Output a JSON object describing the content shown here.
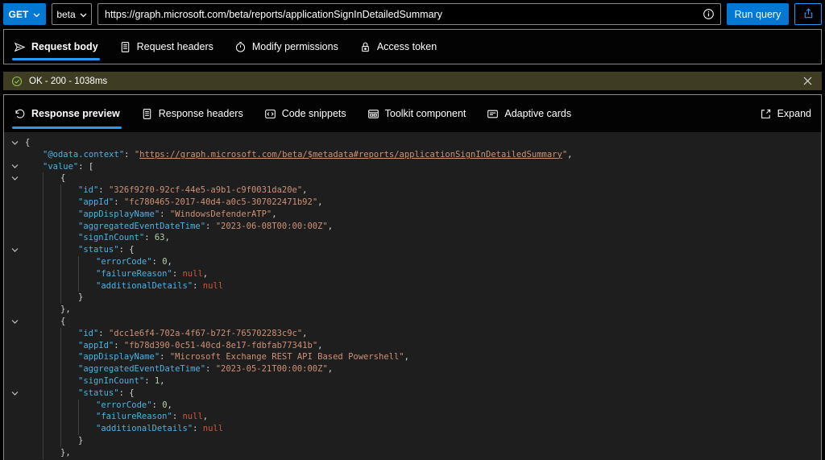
{
  "request_bar": {
    "method": "GET",
    "version": "beta",
    "url": "https://graph.microsoft.com/beta/reports/applicationSignInDetailedSummary",
    "run_label": "Run query"
  },
  "request_tabs": [
    {
      "label": "Request body",
      "icon": "send-icon",
      "active": true
    },
    {
      "label": "Request headers",
      "icon": "document-icon",
      "active": false
    },
    {
      "label": "Modify permissions",
      "icon": "permissions-icon",
      "active": false
    },
    {
      "label": "Access token",
      "icon": "lock-icon",
      "active": false
    }
  ],
  "status_banner": {
    "icon": "success-check-icon",
    "text": "OK - 200 - 1038ms",
    "close": "close-icon"
  },
  "response_tabs": [
    {
      "label": "Response preview",
      "icon": "undo-icon",
      "active": true
    },
    {
      "label": "Response headers",
      "icon": "document-icon",
      "active": false
    },
    {
      "label": "Code snippets",
      "icon": "code-icon",
      "active": false
    },
    {
      "label": "Toolkit component",
      "icon": "toolkit-icon",
      "active": false
    },
    {
      "label": "Adaptive cards",
      "icon": "card-icon",
      "active": false
    }
  ],
  "expand": {
    "label": "Expand",
    "icon": "expand-icon"
  },
  "colors": {
    "accent": "#0078d4",
    "active_tab_underline": "#2899f5",
    "status_bg": "#3e3d24",
    "status_check": "#92c353",
    "editor_bg": "#1e1e1e",
    "json_key": "#4db2e2",
    "json_string": "#ce9178",
    "json_number": "#b5cea8",
    "json_null": "#d0583a",
    "json_punct": "#d4d4d4"
  },
  "editor": {
    "lines": [
      {
        "c": true,
        "i": 0,
        "tk": [
          [
            "p",
            "{"
          ]
        ]
      },
      {
        "c": false,
        "i": 1,
        "tk": [
          [
            "k",
            "\"@odata.context\""
          ],
          [
            "p",
            ": "
          ],
          [
            "s",
            "\""
          ],
          [
            "l",
            "https://graph.microsoft.com/beta/$metadata#reports/applicationSignInDetailedSummary"
          ],
          [
            "s",
            "\""
          ],
          [
            "p",
            ","
          ]
        ]
      },
      {
        "c": true,
        "i": 1,
        "tk": [
          [
            "k",
            "\"value\""
          ],
          [
            "p",
            ": ["
          ]
        ]
      },
      {
        "c": true,
        "i": 2,
        "tk": [
          [
            "p",
            "{"
          ]
        ]
      },
      {
        "c": false,
        "i": 3,
        "tk": [
          [
            "k",
            "\"id\""
          ],
          [
            "p",
            ": "
          ],
          [
            "s",
            "\"326f92f0-92cf-44e5-a9b1-c9f0031da20e\""
          ],
          [
            "p",
            ","
          ]
        ]
      },
      {
        "c": false,
        "i": 3,
        "tk": [
          [
            "k",
            "\"appId\""
          ],
          [
            "p",
            ": "
          ],
          [
            "s",
            "\"fc780465-2017-40d4-a0c5-307022471b92\""
          ],
          [
            "p",
            ","
          ]
        ]
      },
      {
        "c": false,
        "i": 3,
        "tk": [
          [
            "k",
            "\"appDisplayName\""
          ],
          [
            "p",
            ": "
          ],
          [
            "s",
            "\"WindowsDefenderATP\""
          ],
          [
            "p",
            ","
          ]
        ]
      },
      {
        "c": false,
        "i": 3,
        "tk": [
          [
            "k",
            "\"aggregatedEventDateTime\""
          ],
          [
            "p",
            ": "
          ],
          [
            "s",
            "\"2023-06-08T00:00:00Z\""
          ],
          [
            "p",
            ","
          ]
        ]
      },
      {
        "c": false,
        "i": 3,
        "tk": [
          [
            "k",
            "\"signInCount\""
          ],
          [
            "p",
            ": "
          ],
          [
            "n",
            "63"
          ],
          [
            "p",
            ","
          ]
        ]
      },
      {
        "c": true,
        "i": 3,
        "tk": [
          [
            "k",
            "\"status\""
          ],
          [
            "p",
            ": {"
          ]
        ]
      },
      {
        "c": false,
        "i": 4,
        "tk": [
          [
            "k",
            "\"errorCode\""
          ],
          [
            "p",
            ": "
          ],
          [
            "n",
            "0"
          ],
          [
            "p",
            ","
          ]
        ]
      },
      {
        "c": false,
        "i": 4,
        "tk": [
          [
            "k",
            "\"failureReason\""
          ],
          [
            "p",
            ": "
          ],
          [
            "u",
            "null"
          ],
          [
            "p",
            ","
          ]
        ]
      },
      {
        "c": false,
        "i": 4,
        "tk": [
          [
            "k",
            "\"additionalDetails\""
          ],
          [
            "p",
            ": "
          ],
          [
            "u",
            "null"
          ]
        ]
      },
      {
        "c": false,
        "i": 3,
        "tk": [
          [
            "p",
            "}"
          ]
        ]
      },
      {
        "c": false,
        "i": 2,
        "tk": [
          [
            "p",
            "},"
          ]
        ]
      },
      {
        "c": true,
        "i": 2,
        "tk": [
          [
            "p",
            "{"
          ]
        ]
      },
      {
        "c": false,
        "i": 3,
        "tk": [
          [
            "k",
            "\"id\""
          ],
          [
            "p",
            ": "
          ],
          [
            "s",
            "\"dcc1e6f4-702a-4f67-b72f-765702283c9c\""
          ],
          [
            "p",
            ","
          ]
        ]
      },
      {
        "c": false,
        "i": 3,
        "tk": [
          [
            "k",
            "\"appId\""
          ],
          [
            "p",
            ": "
          ],
          [
            "s",
            "\"fb78d390-0c51-40cd-8e17-fdbfab77341b\""
          ],
          [
            "p",
            ","
          ]
        ]
      },
      {
        "c": false,
        "i": 3,
        "tk": [
          [
            "k",
            "\"appDisplayName\""
          ],
          [
            "p",
            ": "
          ],
          [
            "s",
            "\"Microsoft Exchange REST API Based Powershell\""
          ],
          [
            "p",
            ","
          ]
        ]
      },
      {
        "c": false,
        "i": 3,
        "tk": [
          [
            "k",
            "\"aggregatedEventDateTime\""
          ],
          [
            "p",
            ": "
          ],
          [
            "s",
            "\"2023-05-21T00:00:00Z\""
          ],
          [
            "p",
            ","
          ]
        ]
      },
      {
        "c": false,
        "i": 3,
        "tk": [
          [
            "k",
            "\"signInCount\""
          ],
          [
            "p",
            ": "
          ],
          [
            "n",
            "1"
          ],
          [
            "p",
            ","
          ]
        ]
      },
      {
        "c": true,
        "i": 3,
        "tk": [
          [
            "k",
            "\"status\""
          ],
          [
            "p",
            ": {"
          ]
        ]
      },
      {
        "c": false,
        "i": 4,
        "tk": [
          [
            "k",
            "\"errorCode\""
          ],
          [
            "p",
            ": "
          ],
          [
            "n",
            "0"
          ],
          [
            "p",
            ","
          ]
        ]
      },
      {
        "c": false,
        "i": 4,
        "tk": [
          [
            "k",
            "\"failureReason\""
          ],
          [
            "p",
            ": "
          ],
          [
            "u",
            "null"
          ],
          [
            "p",
            ","
          ]
        ]
      },
      {
        "c": false,
        "i": 4,
        "tk": [
          [
            "k",
            "\"additionalDetails\""
          ],
          [
            "p",
            ": "
          ],
          [
            "u",
            "null"
          ]
        ]
      },
      {
        "c": false,
        "i": 3,
        "tk": [
          [
            "p",
            "}"
          ]
        ]
      },
      {
        "c": false,
        "i": 2,
        "tk": [
          [
            "p",
            "},"
          ]
        ]
      }
    ]
  }
}
